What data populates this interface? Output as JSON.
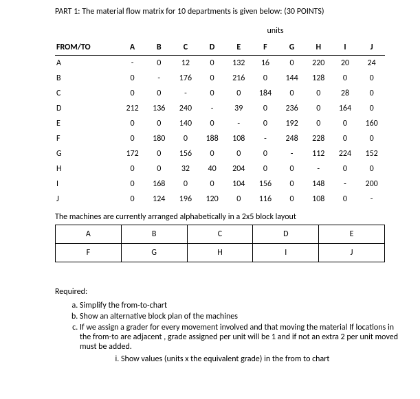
{
  "title": "PART 1: The material flow matrix for 10 departments is given below: (30 POINTS)",
  "units_label": "units",
  "matrix": {
    "from_to_header": "FROM/TO",
    "cols": [
      "A",
      "B",
      "C",
      "D",
      "E",
      "F",
      "G",
      "H",
      "I",
      "J"
    ],
    "rows": [
      {
        "label": "A",
        "cells": [
          "-",
          "0",
          "12",
          "0",
          "132",
          "16",
          "0",
          "220",
          "20",
          "24"
        ]
      },
      {
        "label": "B",
        "cells": [
          "0",
          "-",
          "176",
          "0",
          "216",
          "0",
          "144",
          "128",
          "0",
          "0"
        ]
      },
      {
        "label": "C",
        "cells": [
          "0",
          "0",
          "-",
          "0",
          "0",
          "184",
          "0",
          "0",
          "28",
          "0"
        ]
      },
      {
        "label": "D",
        "cells": [
          "212",
          "136",
          "240",
          "-",
          "39",
          "0",
          "236",
          "0",
          "164",
          "0"
        ]
      },
      {
        "label": "E",
        "cells": [
          "0",
          "0",
          "140",
          "0",
          "-",
          "0",
          "192",
          "0",
          "0",
          "160"
        ]
      },
      {
        "label": "F",
        "cells": [
          "0",
          "180",
          "0",
          "188",
          "108",
          "-",
          "248",
          "228",
          "0",
          "0"
        ]
      },
      {
        "label": "G",
        "cells": [
          "172",
          "0",
          "156",
          "0",
          "0",
          "0",
          "-",
          "112",
          "224",
          "152"
        ]
      },
      {
        "label": "H",
        "cells": [
          "0",
          "0",
          "32",
          "40",
          "204",
          "0",
          "0",
          "-",
          "0",
          "0"
        ]
      },
      {
        "label": "I",
        "cells": [
          "0",
          "168",
          "0",
          "0",
          "104",
          "156",
          "0",
          "148",
          "-",
          "200"
        ]
      },
      {
        "label": "J",
        "cells": [
          "0",
          "124",
          "196",
          "120",
          "0",
          "116",
          "0",
          "108",
          "0",
          "-"
        ]
      }
    ]
  },
  "layout_note": "The machines are currently arranged alphabetically in a 2x5 block layout",
  "layout": [
    [
      "A",
      "B",
      "C",
      "D",
      "E"
    ],
    [
      "F",
      "G",
      "H",
      "I",
      "J"
    ]
  ],
  "required_label": "Required:",
  "req_items": [
    "Simplify the from-to-chart",
    "Show an alternative block plan of the machines",
    "If we assign a grader for every movement involved and that moving the material If locations in the from-to are adjacent , grade assigned per unit will be 1 and if not an extra 2 per unit moved must be added."
  ],
  "sub_item": "Show values (units x the equivalent grade) in the from to chart",
  "chart_data": {
    "type": "table",
    "title": "Material flow matrix for 10 departments (units)",
    "row_labels": [
      "A",
      "B",
      "C",
      "D",
      "E",
      "F",
      "G",
      "H",
      "I",
      "J"
    ],
    "col_labels": [
      "A",
      "B",
      "C",
      "D",
      "E",
      "F",
      "G",
      "H",
      "I",
      "J"
    ],
    "values": [
      [
        null,
        0,
        12,
        0,
        132,
        16,
        0,
        220,
        20,
        24
      ],
      [
        0,
        null,
        176,
        0,
        216,
        0,
        144,
        128,
        0,
        0
      ],
      [
        0,
        0,
        null,
        0,
        0,
        184,
        0,
        0,
        28,
        0
      ],
      [
        212,
        136,
        240,
        null,
        39,
        0,
        236,
        0,
        164,
        0
      ],
      [
        0,
        0,
        140,
        0,
        null,
        0,
        192,
        0,
        0,
        160
      ],
      [
        0,
        180,
        0,
        188,
        108,
        null,
        248,
        228,
        0,
        0
      ],
      [
        172,
        0,
        156,
        0,
        0,
        0,
        null,
        112,
        224,
        152
      ],
      [
        0,
        0,
        32,
        40,
        204,
        0,
        0,
        null,
        0,
        0
      ],
      [
        0,
        168,
        0,
        0,
        104,
        156,
        0,
        148,
        null,
        200
      ],
      [
        0,
        124,
        196,
        120,
        0,
        116,
        0,
        108,
        0,
        null
      ]
    ]
  }
}
